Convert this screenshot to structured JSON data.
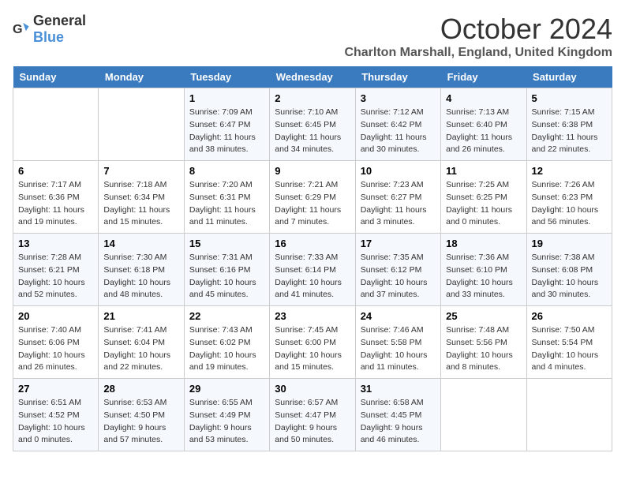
{
  "header": {
    "logo_general": "General",
    "logo_blue": "Blue",
    "title": "October 2024",
    "subtitle": "Charlton Marshall, England, United Kingdom"
  },
  "days_of_week": [
    "Sunday",
    "Monday",
    "Tuesday",
    "Wednesday",
    "Thursday",
    "Friday",
    "Saturday"
  ],
  "weeks": [
    [
      {
        "day": "",
        "sunrise": "",
        "sunset": "",
        "daylight": ""
      },
      {
        "day": "",
        "sunrise": "",
        "sunset": "",
        "daylight": ""
      },
      {
        "day": "1",
        "sunrise": "Sunrise: 7:09 AM",
        "sunset": "Sunset: 6:47 PM",
        "daylight": "Daylight: 11 hours and 38 minutes."
      },
      {
        "day": "2",
        "sunrise": "Sunrise: 7:10 AM",
        "sunset": "Sunset: 6:45 PM",
        "daylight": "Daylight: 11 hours and 34 minutes."
      },
      {
        "day": "3",
        "sunrise": "Sunrise: 7:12 AM",
        "sunset": "Sunset: 6:42 PM",
        "daylight": "Daylight: 11 hours and 30 minutes."
      },
      {
        "day": "4",
        "sunrise": "Sunrise: 7:13 AM",
        "sunset": "Sunset: 6:40 PM",
        "daylight": "Daylight: 11 hours and 26 minutes."
      },
      {
        "day": "5",
        "sunrise": "Sunrise: 7:15 AM",
        "sunset": "Sunset: 6:38 PM",
        "daylight": "Daylight: 11 hours and 22 minutes."
      }
    ],
    [
      {
        "day": "6",
        "sunrise": "Sunrise: 7:17 AM",
        "sunset": "Sunset: 6:36 PM",
        "daylight": "Daylight: 11 hours and 19 minutes."
      },
      {
        "day": "7",
        "sunrise": "Sunrise: 7:18 AM",
        "sunset": "Sunset: 6:34 PM",
        "daylight": "Daylight: 11 hours and 15 minutes."
      },
      {
        "day": "8",
        "sunrise": "Sunrise: 7:20 AM",
        "sunset": "Sunset: 6:31 PM",
        "daylight": "Daylight: 11 hours and 11 minutes."
      },
      {
        "day": "9",
        "sunrise": "Sunrise: 7:21 AM",
        "sunset": "Sunset: 6:29 PM",
        "daylight": "Daylight: 11 hours and 7 minutes."
      },
      {
        "day": "10",
        "sunrise": "Sunrise: 7:23 AM",
        "sunset": "Sunset: 6:27 PM",
        "daylight": "Daylight: 11 hours and 3 minutes."
      },
      {
        "day": "11",
        "sunrise": "Sunrise: 7:25 AM",
        "sunset": "Sunset: 6:25 PM",
        "daylight": "Daylight: 11 hours and 0 minutes."
      },
      {
        "day": "12",
        "sunrise": "Sunrise: 7:26 AM",
        "sunset": "Sunset: 6:23 PM",
        "daylight": "Daylight: 10 hours and 56 minutes."
      }
    ],
    [
      {
        "day": "13",
        "sunrise": "Sunrise: 7:28 AM",
        "sunset": "Sunset: 6:21 PM",
        "daylight": "Daylight: 10 hours and 52 minutes."
      },
      {
        "day": "14",
        "sunrise": "Sunrise: 7:30 AM",
        "sunset": "Sunset: 6:18 PM",
        "daylight": "Daylight: 10 hours and 48 minutes."
      },
      {
        "day": "15",
        "sunrise": "Sunrise: 7:31 AM",
        "sunset": "Sunset: 6:16 PM",
        "daylight": "Daylight: 10 hours and 45 minutes."
      },
      {
        "day": "16",
        "sunrise": "Sunrise: 7:33 AM",
        "sunset": "Sunset: 6:14 PM",
        "daylight": "Daylight: 10 hours and 41 minutes."
      },
      {
        "day": "17",
        "sunrise": "Sunrise: 7:35 AM",
        "sunset": "Sunset: 6:12 PM",
        "daylight": "Daylight: 10 hours and 37 minutes."
      },
      {
        "day": "18",
        "sunrise": "Sunrise: 7:36 AM",
        "sunset": "Sunset: 6:10 PM",
        "daylight": "Daylight: 10 hours and 33 minutes."
      },
      {
        "day": "19",
        "sunrise": "Sunrise: 7:38 AM",
        "sunset": "Sunset: 6:08 PM",
        "daylight": "Daylight: 10 hours and 30 minutes."
      }
    ],
    [
      {
        "day": "20",
        "sunrise": "Sunrise: 7:40 AM",
        "sunset": "Sunset: 6:06 PM",
        "daylight": "Daylight: 10 hours and 26 minutes."
      },
      {
        "day": "21",
        "sunrise": "Sunrise: 7:41 AM",
        "sunset": "Sunset: 6:04 PM",
        "daylight": "Daylight: 10 hours and 22 minutes."
      },
      {
        "day": "22",
        "sunrise": "Sunrise: 7:43 AM",
        "sunset": "Sunset: 6:02 PM",
        "daylight": "Daylight: 10 hours and 19 minutes."
      },
      {
        "day": "23",
        "sunrise": "Sunrise: 7:45 AM",
        "sunset": "Sunset: 6:00 PM",
        "daylight": "Daylight: 10 hours and 15 minutes."
      },
      {
        "day": "24",
        "sunrise": "Sunrise: 7:46 AM",
        "sunset": "Sunset: 5:58 PM",
        "daylight": "Daylight: 10 hours and 11 minutes."
      },
      {
        "day": "25",
        "sunrise": "Sunrise: 7:48 AM",
        "sunset": "Sunset: 5:56 PM",
        "daylight": "Daylight: 10 hours and 8 minutes."
      },
      {
        "day": "26",
        "sunrise": "Sunrise: 7:50 AM",
        "sunset": "Sunset: 5:54 PM",
        "daylight": "Daylight: 10 hours and 4 minutes."
      }
    ],
    [
      {
        "day": "27",
        "sunrise": "Sunrise: 6:51 AM",
        "sunset": "Sunset: 4:52 PM",
        "daylight": "Daylight: 10 hours and 0 minutes."
      },
      {
        "day": "28",
        "sunrise": "Sunrise: 6:53 AM",
        "sunset": "Sunset: 4:50 PM",
        "daylight": "Daylight: 9 hours and 57 minutes."
      },
      {
        "day": "29",
        "sunrise": "Sunrise: 6:55 AM",
        "sunset": "Sunset: 4:49 PM",
        "daylight": "Daylight: 9 hours and 53 minutes."
      },
      {
        "day": "30",
        "sunrise": "Sunrise: 6:57 AM",
        "sunset": "Sunset: 4:47 PM",
        "daylight": "Daylight: 9 hours and 50 minutes."
      },
      {
        "day": "31",
        "sunrise": "Sunrise: 6:58 AM",
        "sunset": "Sunset: 4:45 PM",
        "daylight": "Daylight: 9 hours and 46 minutes."
      },
      {
        "day": "",
        "sunrise": "",
        "sunset": "",
        "daylight": ""
      },
      {
        "day": "",
        "sunrise": "",
        "sunset": "",
        "daylight": ""
      }
    ]
  ]
}
